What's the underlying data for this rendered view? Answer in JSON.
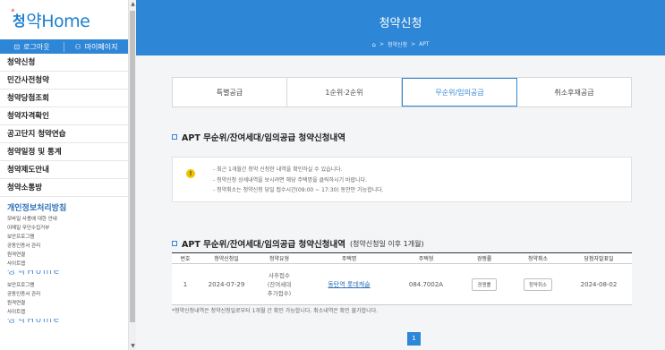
{
  "sidebar": {
    "logo_k": "청",
    "logo_star": "*",
    "logo_rest": "약Home",
    "login_label": "로그아웃",
    "mypage_label": "마이페이지",
    "menu": [
      "청약신청",
      "민간사전청약",
      "청약당첨조회",
      "청약자격확인",
      "공고단지 청약연습",
      "청약일정 및 통계",
      "청약제도안내",
      "청약소통방"
    ],
    "privacy_title": "개인정보처리방침",
    "privacy_items": [
      "모바일 사용에 대한 안내",
      "이메일 무단수집거부",
      "보안프로그램",
      "공동인증서 관리",
      "원격연결",
      "사이트맵"
    ],
    "blurred_heading": "청약Home",
    "second_items": [
      "보안프로그램",
      "공동인증서 관리",
      "원격연결",
      "사이트맵"
    ]
  },
  "header": {
    "title": "청약신청",
    "breadcrumb": [
      "청약신청",
      "APT"
    ]
  },
  "tabs": [
    {
      "label": "특별공급",
      "active": false
    },
    {
      "label": "1순위·2순위",
      "active": false
    },
    {
      "label": "무순위/임의공급",
      "active": true
    },
    {
      "label": "취소후재공급",
      "active": false
    }
  ],
  "section1": {
    "title": "APT 무순위/잔여세대/임의공급 청약신청내역"
  },
  "notice": {
    "items": [
      "최근 1개월간 청약 신청한 내역을 확인하실 수 있습니다.",
      "청약신청 상세내역을 보시려면 해당 주택명을 클릭하시기 바랍니다.",
      "청약취소는 청약신청 당일 접수시간(09:00 ~ 17:30) 동안만 가능합니다."
    ]
  },
  "section2": {
    "title": "APT 무순위/잔여세대/임의공급 청약신청내역",
    "note": "(청약신청일 이후 1개월)"
  },
  "table": {
    "headers": [
      "번호",
      "청약신청일",
      "청약유형",
      "주택명",
      "주택형",
      "경쟁률",
      "청약취소",
      "당첨자발표일"
    ],
    "row": {
      "no": "1",
      "date": "2024-07-29",
      "type_line1": "사후접수",
      "type_line2": "(잔여세대",
      "type_line3": "추가접수)",
      "house": "동탄역 롯데캐슬",
      "size": "084.7002A",
      "rate_btn": "경쟁률",
      "cancel_btn": "청약취소",
      "announce": "2024-08-02"
    }
  },
  "footnote": "*청약신청내역은 청약신청일로부터 1개월 간 확인 가능합니다. 취소내역은 확인 불가합니다.",
  "pager": {
    "current": "1"
  }
}
